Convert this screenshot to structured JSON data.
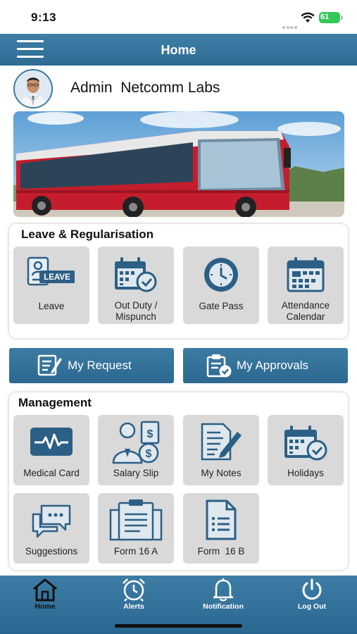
{
  "status_bar": {
    "time": "9:13",
    "battery": "61"
  },
  "app_bar": {
    "title": "Home",
    "menu_icon": "hamburger-icon"
  },
  "profile": {
    "name": "Admin  Netcomm Labs"
  },
  "leave_section": {
    "title": "Leave & Regularisation",
    "tiles": [
      {
        "label": "Leave",
        "icon": "leave-icon",
        "badge": "LEAVE"
      },
      {
        "label": "Out Duty /\nMispunch",
        "icon": "calendar-check-icon"
      },
      {
        "label": "Gate Pass",
        "icon": "clock-icon"
      },
      {
        "label": "Attendance\nCalendar",
        "icon": "calendar-icon"
      }
    ]
  },
  "actions": {
    "my_request": {
      "label": "My Request",
      "icon": "edit-document-icon"
    },
    "my_approvals": {
      "label": "My Approvals",
      "icon": "clipboard-check-icon"
    }
  },
  "management_section": {
    "title": "Management",
    "tiles": [
      {
        "label": "Medical Card",
        "icon": "heartbeat-icon"
      },
      {
        "label": "Salary Slip",
        "icon": "salary-icon"
      },
      {
        "label": "My Notes",
        "icon": "notes-icon"
      },
      {
        "label": "Holidays",
        "icon": "calendar-check-icon"
      },
      {
        "label": "Suggestions",
        "icon": "chat-icon"
      },
      {
        "label": "Form 16 A",
        "icon": "clipboard-icon"
      },
      {
        "label": "Form  16 B",
        "icon": "document-icon"
      }
    ]
  },
  "bottom_nav": [
    {
      "label": "Home",
      "icon": "home-icon"
    },
    {
      "label": "Alerts",
      "icon": "alarm-clock-icon"
    },
    {
      "label": "Notification",
      "icon": "bell-icon"
    },
    {
      "label": "Log Out",
      "icon": "power-icon"
    }
  ],
  "colors": {
    "primary": "#2e6e96",
    "tile": "#d9d9d9",
    "icon": "#2c5f85"
  }
}
